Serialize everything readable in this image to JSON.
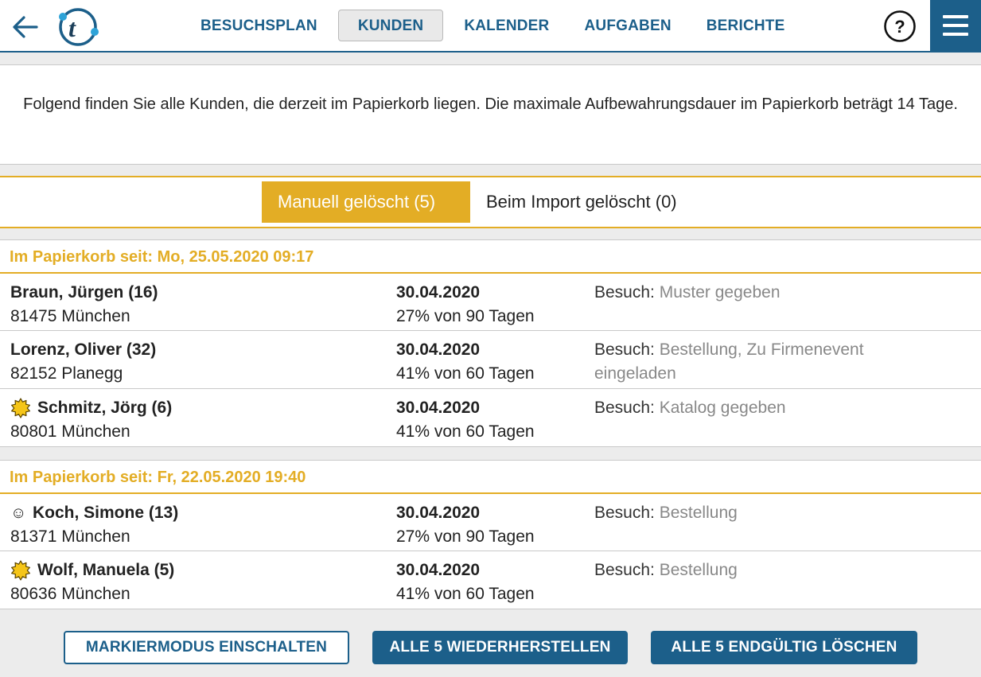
{
  "nav": {
    "items": [
      {
        "label": "BESUCHSPLAN",
        "active": false
      },
      {
        "label": "KUNDEN",
        "active": true
      },
      {
        "label": "KALENDER",
        "active": false
      },
      {
        "label": "AUFGABEN",
        "active": false
      },
      {
        "label": "BERICHTE",
        "active": false
      }
    ],
    "help_icon": "question-circle-icon",
    "menu_icon": "hamburger-icon",
    "back_icon": "arrow-left-icon"
  },
  "info": {
    "text": "Folgend finden Sie alle Kunden, die derzeit im Papierkorb liegen. Die maximale Aufbewahrungsdauer im Papierkorb beträgt 14 Tage."
  },
  "tabs": {
    "manual": "Manuell gelöscht (5)",
    "import": "Beim Import gelöscht (0)"
  },
  "groups": [
    {
      "header": "Im Papierkorb seit: Mo, 25.05.2020 09:17",
      "rows": [
        {
          "name": "Braun, Jürgen (16)",
          "city": "81475 München",
          "date": "30.04.2020",
          "progress": "27% von 90 Tagen",
          "visit_label": "Besuch:",
          "visit_value": "Muster gegeben",
          "icon": ""
        },
        {
          "name": "Lorenz, Oliver (32)",
          "city": "82152 Planegg",
          "date": "30.04.2020",
          "progress": "41% von 60 Tagen",
          "visit_label": "Besuch:",
          "visit_value": "Bestellung, Zu Firmenevent eingeladen",
          "icon": ""
        },
        {
          "name": "Schmitz, Jörg (6)",
          "city": "80801 München",
          "date": "30.04.2020",
          "progress": "41% von 60 Tagen",
          "visit_label": "Besuch:",
          "visit_value": "Katalog gegeben",
          "icon": "sun-badge-icon"
        }
      ]
    },
    {
      "header": "Im Papierkorb seit: Fr, 22.05.2020 19:40",
      "rows": [
        {
          "name": "Koch, Simone (13)",
          "city": "81371 München",
          "date": "30.04.2020",
          "progress": "27% von 90 Tagen",
          "visit_label": "Besuch:",
          "visit_value": "Bestellung",
          "icon": "smiley-icon",
          "icon_glyph": "☺"
        },
        {
          "name": "Wolf, Manuela (5)",
          "city": "80636 München",
          "date": "30.04.2020",
          "progress": "41% von 60 Tagen",
          "visit_label": "Besuch:",
          "visit_value": "Bestellung",
          "icon": "sun-badge-icon"
        }
      ]
    }
  ],
  "buttons": {
    "mark_mode": "MARKIERMODUS EINSCHALTEN",
    "restore_all": "ALLE 5 WIEDERHERSTELLEN",
    "delete_all": "ALLE 5 ENDGÜLTIG LÖSCHEN"
  },
  "colors": {
    "primary": "#1c5f8a",
    "accent": "#e3ad25",
    "muted_text": "#888888",
    "badge_yellow": "#f5c518"
  }
}
